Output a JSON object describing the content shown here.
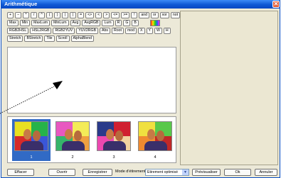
{
  "window": {
    "title": "Arithmétique",
    "close_glyph": "✕"
  },
  "toolbar": {
    "row1": [
      "+",
      "−",
      "*",
      "/",
      "^",
      "(",
      ")",
      "|",
      "|",
      "=",
      "<>",
      "<",
      ">",
      "<=",
      ">=",
      "!",
      "and",
      "or",
      "xor",
      "not"
    ],
    "row2": [
      "Max",
      "Min",
      "MaxLum",
      "MinLum",
      "Avg",
      "AvgRGB",
      "Lum",
      "R",
      "G",
      "B"
    ],
    "row3": [
      "RGB2HSL",
      "HSL2RGB",
      "RGB2YUV",
      "YUV2RGB",
      "Abs",
      "Root",
      "mod",
      "X",
      "Y",
      "W",
      "H"
    ],
    "row4": [
      "Stretch",
      "BStretch",
      "Tile",
      "Scroll",
      "AlphaBlend"
    ],
    "color_swatch": [
      "#ff2020",
      "#ffe000",
      "#20d020",
      "#2060ff",
      "#ff20ff"
    ]
  },
  "thumbnails": [
    {
      "label": "1",
      "selected": true,
      "colors": [
        "#e8e020",
        "#26b34a",
        "#d62a2a",
        "#3a56d8"
      ]
    },
    {
      "label": "2",
      "selected": false,
      "colors": [
        "#e858c0",
        "#f4ec58",
        "#35b56a",
        "#f0a040"
      ]
    },
    {
      "label": "3",
      "selected": false,
      "colors": [
        "#2a3a8a",
        "#d02030",
        "#ec48b0",
        "#f2d2a0"
      ]
    },
    {
      "label": "4",
      "selected": false,
      "colors": [
        "#f0e040",
        "#58c84a",
        "#f08a30",
        "#c02828"
      ]
    }
  ],
  "footer": {
    "effacer": "Effacer",
    "ouvrir": "Ouvrir",
    "enregistrer": "Enregistrer",
    "mode_label": "Mode d'étirement",
    "mode_value": "Etirement optimisé",
    "previsualiser": "Prévisualiser",
    "ok": "Ok",
    "annuler": "Annuler"
  }
}
